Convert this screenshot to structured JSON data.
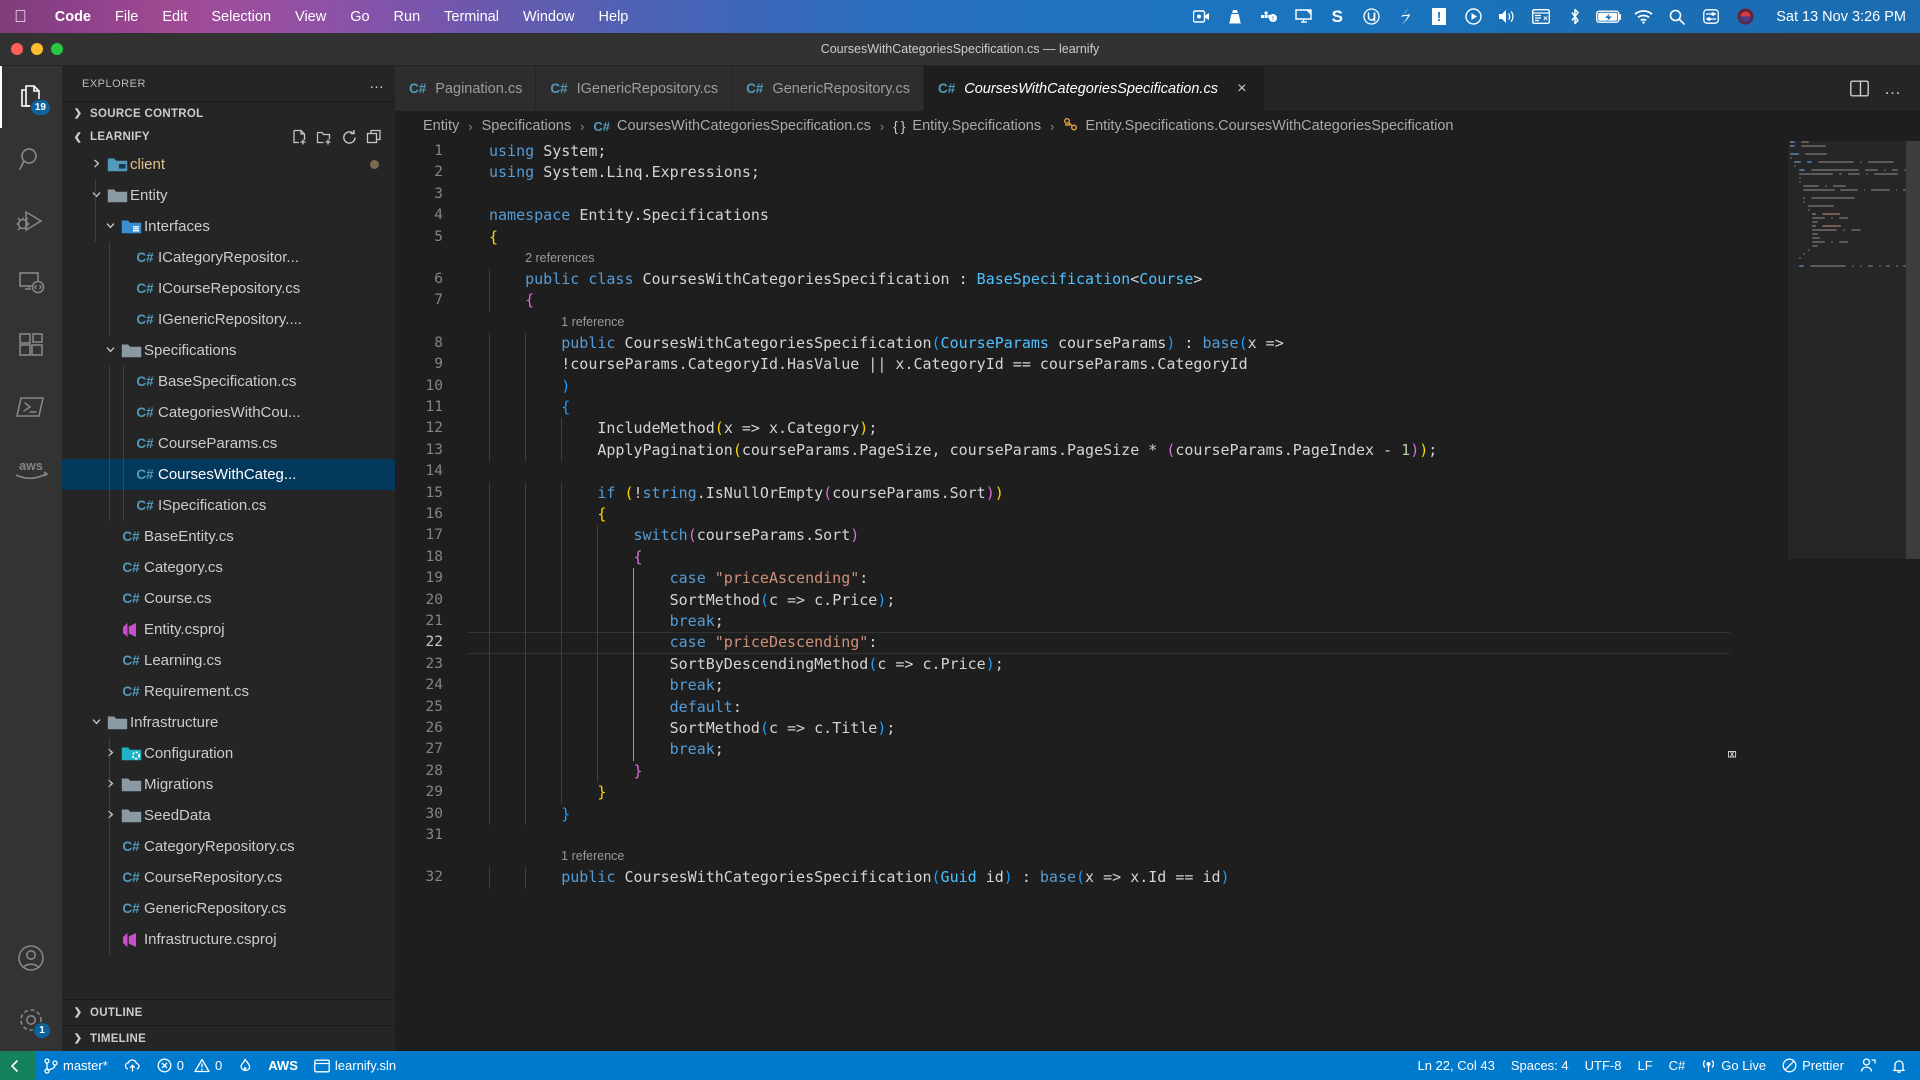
{
  "macos": {
    "apple_icon": "apple-logo",
    "menus": [
      {
        "label": "Code",
        "bold": true
      },
      {
        "label": "File",
        "bold": false
      },
      {
        "label": "Edit",
        "bold": false
      },
      {
        "label": "Selection",
        "bold": false
      },
      {
        "label": "View",
        "bold": false
      },
      {
        "label": "Go",
        "bold": false
      },
      {
        "label": "Run",
        "bold": false
      },
      {
        "label": "Terminal",
        "bold": false
      },
      {
        "label": "Window",
        "bold": false
      },
      {
        "label": "Help",
        "bold": false
      }
    ],
    "tray": [
      {
        "name": "screen-recorder-icon",
        "glyph": "▣"
      },
      {
        "name": "vlc-icon",
        "glyph": "▲"
      },
      {
        "name": "docker-icon",
        "glyph": "☸"
      },
      {
        "name": "display-icon",
        "glyph": "⬛"
      },
      {
        "name": "shell-s-icon",
        "glyph": "S"
      },
      {
        "name": "utorrent-icon",
        "glyph": "Ⓥ"
      },
      {
        "name": "slash-icon",
        "glyph": "╱"
      },
      {
        "name": "alert-icon",
        "glyph": "!"
      },
      {
        "name": "play-icon",
        "glyph": "▶"
      },
      {
        "name": "volume-icon",
        "glyph": "◀"
      },
      {
        "name": "clipboard-icon",
        "glyph": "▤"
      },
      {
        "name": "bluetooth-icon",
        "glyph": "ᛦ"
      },
      {
        "name": "battery-icon",
        "glyph": "⚡"
      },
      {
        "name": "wifi-icon",
        "glyph": "◠"
      },
      {
        "name": "spotlight-search-icon",
        "glyph": "⌕"
      },
      {
        "name": "control-center-icon",
        "glyph": "☰"
      },
      {
        "name": "siri-icon",
        "glyph": "◉"
      }
    ],
    "clock": "Sat 13 Nov  3:26 PM"
  },
  "window": {
    "title": "CoursesWithCategoriesSpecification.cs — learnify"
  },
  "activitybar": {
    "items": [
      {
        "name": "explorer",
        "icon": "files-icon",
        "badge": "19",
        "active": true
      },
      {
        "name": "search",
        "icon": "search-icon",
        "badge": "",
        "active": false
      },
      {
        "name": "run-and-debug",
        "icon": "debug-icon",
        "badge": "",
        "active": false
      },
      {
        "name": "remote-explorer",
        "icon": "remote-icon",
        "badge": "",
        "active": false
      },
      {
        "name": "extensions",
        "icon": "extensions-icon",
        "badge": "",
        "active": false
      },
      {
        "name": "powershell",
        "icon": "terminal-icon",
        "badge": "",
        "active": false
      },
      {
        "name": "aws-toolkit",
        "icon": "aws-icon",
        "badge": "",
        "active": false
      }
    ],
    "bottom": [
      {
        "name": "accounts",
        "icon": "account-icon",
        "badge": ""
      },
      {
        "name": "manage-settings",
        "icon": "gear-icon",
        "badge": "1"
      }
    ]
  },
  "sidebar": {
    "title": "EXPLORER",
    "more_actions": "…",
    "source_control_section": "SOURCE CONTROL",
    "project_section": "LEARNIFY",
    "project_actions": [
      {
        "name": "new-file-icon",
        "glyph": "new-file"
      },
      {
        "name": "new-folder-icon",
        "glyph": "new-folder"
      },
      {
        "name": "refresh-explorer-icon",
        "glyph": "refresh"
      },
      {
        "name": "collapse-folders-icon",
        "glyph": "collapse"
      }
    ],
    "outline_section": "OUTLINE",
    "timeline_section": "TIMELINE",
    "tree": [
      {
        "label": "client",
        "type": "folder",
        "icon": "folder-client",
        "indent": 1,
        "expanded": false,
        "modified": true,
        "color": "orange"
      },
      {
        "label": "Entity",
        "type": "folder",
        "icon": "folder",
        "indent": 1,
        "expanded": true
      },
      {
        "label": "Interfaces",
        "type": "folder",
        "icon": "folder-interfaces",
        "indent": 2,
        "expanded": true
      },
      {
        "label": "ICategoryRepositor...",
        "type": "file",
        "icon": "csharp",
        "indent": 3
      },
      {
        "label": "ICourseRepository.cs",
        "type": "file",
        "icon": "csharp",
        "indent": 3
      },
      {
        "label": "IGenericRepository....",
        "type": "file",
        "icon": "csharp",
        "indent": 3
      },
      {
        "label": "Specifications",
        "type": "folder",
        "icon": "folder",
        "indent": 2,
        "expanded": true
      },
      {
        "label": "BaseSpecification.cs",
        "type": "file",
        "icon": "csharp",
        "indent": 3
      },
      {
        "label": "CategoriesWithCou...",
        "type": "file",
        "icon": "csharp",
        "indent": 3
      },
      {
        "label": "CourseParams.cs",
        "type": "file",
        "icon": "csharp",
        "indent": 3
      },
      {
        "label": "CoursesWithCateg...",
        "type": "file",
        "icon": "csharp",
        "indent": 3,
        "selected": true
      },
      {
        "label": "ISpecification.cs",
        "type": "file",
        "icon": "csharp",
        "indent": 3
      },
      {
        "label": "BaseEntity.cs",
        "type": "file",
        "icon": "csharp",
        "indent": 2
      },
      {
        "label": "Category.cs",
        "type": "file",
        "icon": "csharp",
        "indent": 2
      },
      {
        "label": "Course.cs",
        "type": "file",
        "icon": "csharp",
        "indent": 2
      },
      {
        "label": "Entity.csproj",
        "type": "file",
        "icon": "csproj",
        "indent": 2
      },
      {
        "label": "Learning.cs",
        "type": "file",
        "icon": "csharp",
        "indent": 2
      },
      {
        "label": "Requirement.cs",
        "type": "file",
        "icon": "csharp",
        "indent": 2
      },
      {
        "label": "Infrastructure",
        "type": "folder",
        "icon": "folder",
        "indent": 1,
        "expanded": true
      },
      {
        "label": "Configuration",
        "type": "folder",
        "icon": "folder-config",
        "indent": 2,
        "expanded": false
      },
      {
        "label": "Migrations",
        "type": "folder",
        "icon": "folder",
        "indent": 2,
        "expanded": false
      },
      {
        "label": "SeedData",
        "type": "folder",
        "icon": "folder",
        "indent": 2,
        "expanded": false
      },
      {
        "label": "CategoryRepository.cs",
        "type": "file",
        "icon": "csharp",
        "indent": 2
      },
      {
        "label": "CourseRepository.cs",
        "type": "file",
        "icon": "csharp",
        "indent": 2
      },
      {
        "label": "GenericRepository.cs",
        "type": "file",
        "icon": "csharp",
        "indent": 2
      },
      {
        "label": "Infrastructure.csproj",
        "type": "file",
        "icon": "csproj",
        "indent": 2
      }
    ]
  },
  "tabs": [
    {
      "label": "Pagination.cs",
      "icon": "csharp",
      "active": false
    },
    {
      "label": "IGenericRepository.cs",
      "icon": "csharp",
      "active": false
    },
    {
      "label": "GenericRepository.cs",
      "icon": "csharp",
      "active": false
    },
    {
      "label": "CoursesWithCategoriesSpecification.cs",
      "icon": "csharp",
      "active": true,
      "close_label": "×"
    }
  ],
  "tab_actions": [
    {
      "name": "split-editor-icon",
      "glyph": "split"
    },
    {
      "name": "more-actions-icon",
      "glyph": "…"
    }
  ],
  "breadcrumbs": [
    {
      "label": "Entity",
      "icon": ""
    },
    {
      "label": "Specifications",
      "icon": ""
    },
    {
      "label": "CoursesWithCategoriesSpecification.cs",
      "icon": "csharp"
    },
    {
      "label": "Entity.Specifications",
      "icon": "namespace"
    },
    {
      "label": "Entity.Specifications.CoursesWithCategoriesSpecification",
      "icon": "class"
    }
  ],
  "code": {
    "language": "C#",
    "codelens": [
      {
        "after_line": 5,
        "text": "2 references"
      },
      {
        "after_line": 7,
        "text": "1 reference"
      },
      {
        "after_line": 31,
        "text": "1 reference"
      }
    ],
    "lines": [
      {
        "n": 1,
        "text": "using System;"
      },
      {
        "n": 2,
        "text": "using System.Linq.Expressions;"
      },
      {
        "n": 3,
        "text": ""
      },
      {
        "n": 4,
        "text": "namespace Entity.Specifications"
      },
      {
        "n": 5,
        "text": "{"
      },
      {
        "n": 6,
        "text": "    public class CoursesWithCategoriesSpecification : BaseSpecification<Course>"
      },
      {
        "n": 7,
        "text": "    {"
      },
      {
        "n": 8,
        "text": "        public CoursesWithCategoriesSpecification(CourseParams courseParams) : base(x =>"
      },
      {
        "n": 9,
        "text": "        !courseParams.CategoryId.HasValue || x.CategoryId == courseParams.CategoryId"
      },
      {
        "n": 10,
        "text": "        )"
      },
      {
        "n": 11,
        "text": "        {"
      },
      {
        "n": 12,
        "text": "            IncludeMethod(x => x.Category);"
      },
      {
        "n": 13,
        "text": "            ApplyPagination(courseParams.PageSize, courseParams.PageSize * (courseParams.PageIndex - 1));"
      },
      {
        "n": 14,
        "text": ""
      },
      {
        "n": 15,
        "text": "            if (!string.IsNullOrEmpty(courseParams.Sort))"
      },
      {
        "n": 16,
        "text": "            {"
      },
      {
        "n": 17,
        "text": "                switch(courseParams.Sort)"
      },
      {
        "n": 18,
        "text": "                {"
      },
      {
        "n": 19,
        "text": "                    case \"priceAscending\":"
      },
      {
        "n": 20,
        "text": "                    SortMethod(c => c.Price);"
      },
      {
        "n": 21,
        "text": "                    break;"
      },
      {
        "n": 22,
        "text": "                    case \"priceDescending\":"
      },
      {
        "n": 23,
        "text": "                    SortByDescendingMethod(c => c.Price);"
      },
      {
        "n": 24,
        "text": "                    break;"
      },
      {
        "n": 25,
        "text": "                    default:"
      },
      {
        "n": 26,
        "text": "                    SortMethod(c => c.Title);"
      },
      {
        "n": 27,
        "text": "                    break;"
      },
      {
        "n": 28,
        "text": "                }"
      },
      {
        "n": 29,
        "text": "            }"
      },
      {
        "n": 30,
        "text": "        }"
      },
      {
        "n": 31,
        "text": ""
      },
      {
        "n": 32,
        "text": "        public CoursesWithCategoriesSpecification(Guid id) : base(x => x.Id == id)"
      }
    ]
  },
  "statusbar": {
    "remote_icon": "remote-window-icon",
    "left": [
      {
        "name": "branch",
        "icon": "source-control-icon",
        "label": "master*"
      },
      {
        "name": "sync",
        "icon": "sync-cloud-icon",
        "label": ""
      },
      {
        "name": "problems",
        "icon": "error-icon",
        "label": "0",
        "icon2": "warning-icon",
        "label2": "0"
      },
      {
        "name": "flame",
        "icon": "flame-icon",
        "label": ""
      },
      {
        "name": "aws",
        "icon": "",
        "label": "AWS"
      },
      {
        "name": "solution",
        "icon": "window-icon",
        "label": "learnify.sln"
      }
    ],
    "right": [
      {
        "name": "cursor-position",
        "icon": "",
        "label": "Ln 22, Col 43"
      },
      {
        "name": "indentation",
        "icon": "",
        "label": "Spaces: 4"
      },
      {
        "name": "encoding",
        "icon": "",
        "label": "UTF-8"
      },
      {
        "name": "eol",
        "icon": "",
        "label": "LF"
      },
      {
        "name": "language-mode",
        "icon": "",
        "label": "C#"
      },
      {
        "name": "go-live",
        "icon": "broadcast-icon",
        "label": "Go Live"
      },
      {
        "name": "prettier",
        "icon": "prettier-icon",
        "label": "Prettier"
      },
      {
        "name": "remote-user",
        "icon": "person-icon",
        "label": ""
      },
      {
        "name": "notifications",
        "icon": "bell-icon",
        "label": ""
      }
    ]
  },
  "colors": {
    "accent": "#007acc",
    "selection": "#04395e",
    "editor_bg": "#1e1e1e",
    "sidebar_bg": "#252526",
    "activitybar_bg": "#333333",
    "remote_green": "#16825d",
    "keyword": "#569cd6",
    "string": "#ce9178",
    "class_ref": "#4fc1ff",
    "bracket_yellow": "#ffd700",
    "bracket_magenta": "#da70d6",
    "bracket_blue": "#179fff"
  }
}
